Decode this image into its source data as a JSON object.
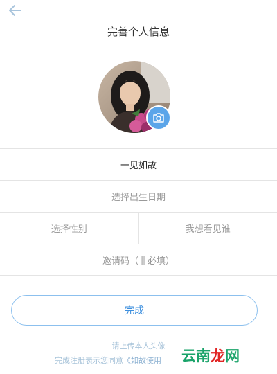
{
  "header": {
    "title": "完善个人信息",
    "back_icon": "arrow-left-icon"
  },
  "avatar": {
    "camera_icon": "camera-icon",
    "accent_color": "#5ba5e9"
  },
  "form": {
    "nickname": "一见如故",
    "birthday_placeholder": "选择出生日期",
    "gender_placeholder": "选择性别",
    "want_to_see_placeholder": "我想看见谁",
    "invite_code_placeholder": "邀请码（非必填）"
  },
  "actions": {
    "done_label": "完成"
  },
  "footer": {
    "hint": "请上传本人头像",
    "agree_prefix": "完成注册表示您同意",
    "agree_link": "《如故使用"
  },
  "watermark": {
    "part1": "云南",
    "part2": "龙",
    "part3": "网"
  }
}
